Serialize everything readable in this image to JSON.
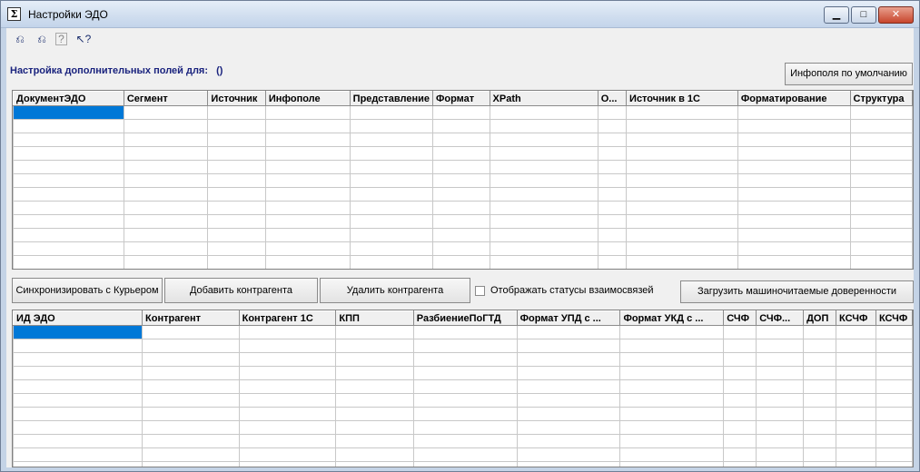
{
  "window": {
    "title": "Настройки ЭДО",
    "icon_glyph": "Σ",
    "min_glyph": "▁",
    "max_glyph": "□",
    "close_glyph": "✕"
  },
  "toolbar": {
    "items": [
      {
        "icon": "restore-settings-icon",
        "glyph": "⎌"
      },
      {
        "icon": "save-settings-icon",
        "glyph": "⎌"
      },
      {
        "icon": "help-icon",
        "glyph": "?"
      },
      {
        "icon": "context-help-icon",
        "glyph": "↖?"
      }
    ]
  },
  "header": {
    "label": "Настройка дополнительных полей для:",
    "value": "()"
  },
  "buttons": {
    "default_infofields": "Инфополя по умолчанию",
    "sync_courier": "Синхронизировать с Курьером",
    "add_counterparty": "Добавить контрагента",
    "delete_counterparty": "Удалить контрагента",
    "load_poa": "Загрузить машиночитаемые доверенности"
  },
  "checkbox": {
    "show_statuses_label": "Отображать статусы взаимосвязей",
    "checked": false
  },
  "grid_top": {
    "columns": [
      "ДокументЭДО",
      "Сегмент",
      "Источник",
      "Инфополе",
      "Представление",
      "Формат",
      "XPath",
      "О...",
      "Источник в 1С",
      "Форматирование",
      "Структура"
    ],
    "rows": 13
  },
  "grid_bottom": {
    "columns": [
      "ИД ЭДО",
      "Контрагент",
      "Контрагент 1С",
      "КПП",
      "РазбиениеПоГТД",
      "Формат УПД с ...",
      "Формат УКД с ...",
      "СЧФ",
      "СЧФ...",
      "ДОП",
      "КСЧФ",
      "КСЧФ"
    ],
    "rows": 11
  },
  "colors": {
    "selection": "#0078d7",
    "heading": "#1a237e"
  }
}
